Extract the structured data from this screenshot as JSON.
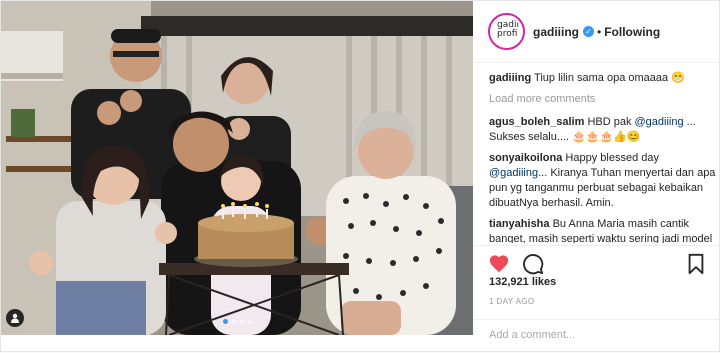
{
  "header": {
    "avatar_text": "gadii profi",
    "username": "gadiiing",
    "separator": "•",
    "follow_status": "Following"
  },
  "caption": {
    "user": "gadiiing",
    "text": "Tiup lilin sama opa omaaaa 😁"
  },
  "load_more": "Load more comments",
  "comments": [
    {
      "user": "agus_boleh_salim",
      "pre": "HBD pak ",
      "mention": "@gadiiing",
      "post": " ... Sukses selalu.... 🎂🎂🎂👍😊"
    },
    {
      "user": "sonyaikoilona",
      "pre": "Happy blessed day ",
      "mention": "@gadiiing",
      "post": "... Kiranya Tuhan menyertai dan apa pun yg tanganmu perbuat sebagai kebaikan dibuatNya berhasil. Amin."
    },
    {
      "user": "tianyahisha",
      "pre": "Bu Anna Maria masih cantik banget, masih seperti waktu sering jadi model dulu ya 😍",
      "mention": "",
      "post": ""
    }
  ],
  "likes": "132,921 likes",
  "date": "1 DAY AGO",
  "add_comment_placeholder": "Add a comment...",
  "icons": {
    "like": "heart-icon",
    "comment": "comment-icon",
    "save": "bookmark-icon",
    "tag": "user-tag-icon"
  },
  "colors": {
    "like_red": "#ed4956",
    "verified_blue": "#3897f0",
    "story_ring": "#d6249f"
  },
  "carousel": {
    "count": 4,
    "active_index": 0
  }
}
